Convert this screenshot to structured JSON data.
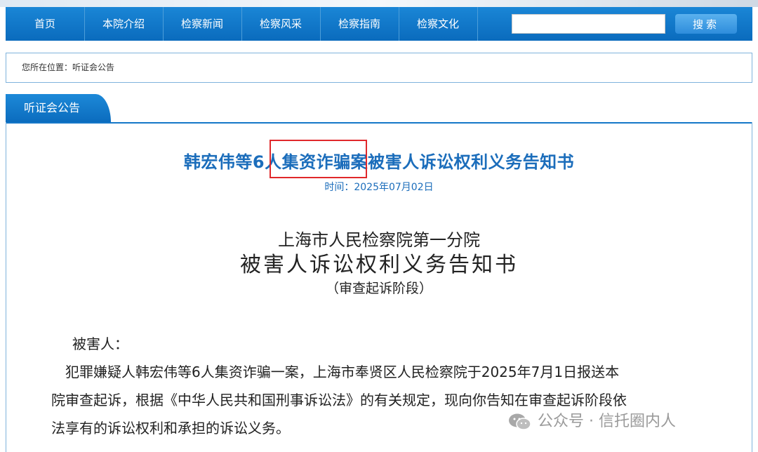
{
  "nav": {
    "items": [
      "首页",
      "本院介绍",
      "检察新闻",
      "检察风采",
      "检察指南",
      "检察文化"
    ],
    "search_placeholder": "",
    "search_button": "搜索"
  },
  "breadcrumb": {
    "label": "您所在位置：",
    "current": "听证会公告"
  },
  "panel": {
    "tab": "听证会公告"
  },
  "article": {
    "title": "韩宏伟等6人集资诈骗案被害人诉讼权利义务告知书",
    "time": "时间：2025年07月02日",
    "org": "上海市人民检察院第一分院",
    "doc_title": "被害人诉讼权利义务告知书",
    "stage": "（审查起诉阶段）",
    "addressee": "被害人：",
    "body_lines": [
      "　犯罪嫌疑人韩宏伟等6人集资诈骗一案，上海市奉贤区人民检察院于2025年7月1日报送本",
      "院审查起诉，根据《中华人民共和国刑事诉讼法》的有关规定，现向你告知在审查起诉阶段依",
      "法享有的诉讼权利和承担的诉讼义务。"
    ]
  },
  "watermark": {
    "text": "公众号 · 信托圈内人"
  },
  "colors": {
    "nav_bg": "#0b72c4",
    "title_blue": "#1b6dbb",
    "highlight_red": "#e0282b"
  }
}
